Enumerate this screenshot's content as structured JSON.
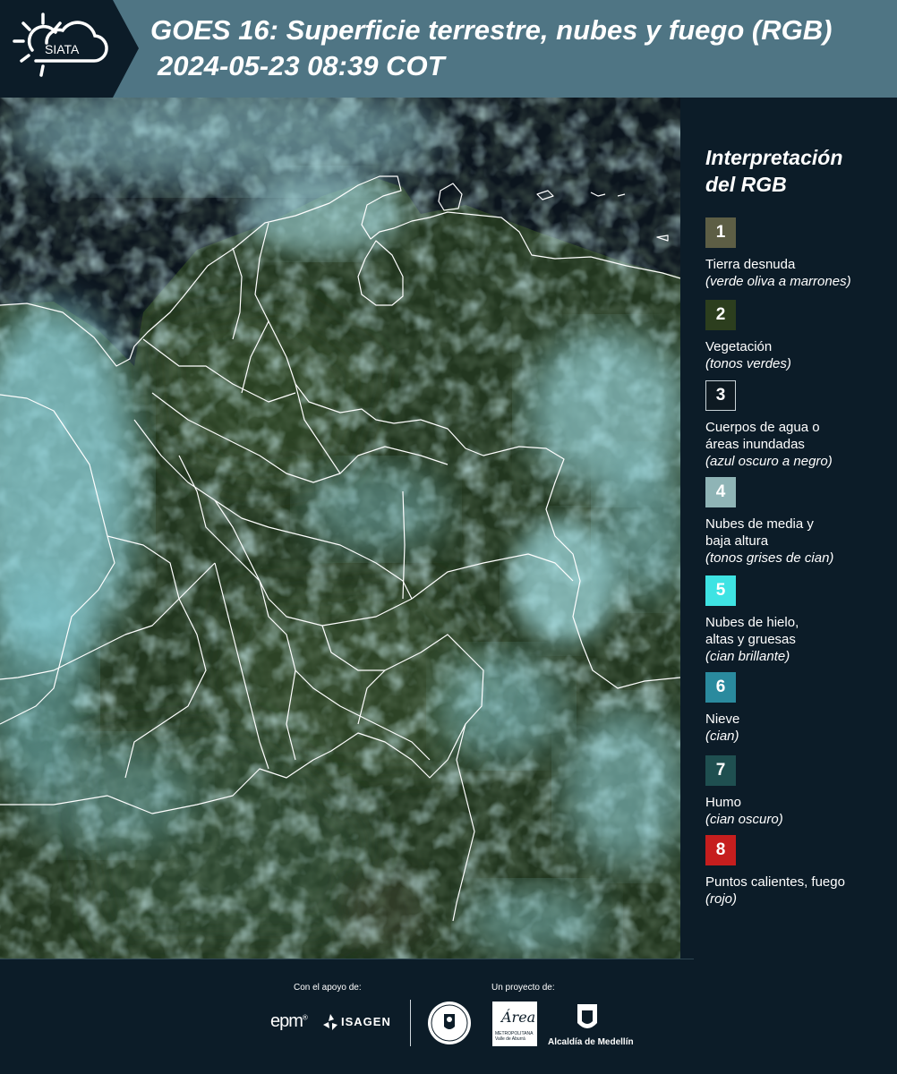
{
  "header": {
    "logo_text": "SIATA",
    "title_line1": "GOES 16: Superficie terrestre, nubes y fuego (RGB)",
    "title_line2": "2024-05-23 08:39 COT"
  },
  "map": {
    "border_color": "#ffffff",
    "land_color": "#2a3e27",
    "water_color": "#0b141d",
    "cloud_color": "#8fd3dc"
  },
  "legend": {
    "title_line1": "Interpretación",
    "title_line2": "del RGB",
    "items": [
      {
        "number": "1",
        "color": "#5d5e45",
        "label_lines": [
          "Tierra desnuda"
        ],
        "desc": "(verde oliva a marrones)"
      },
      {
        "number": "2",
        "color": "#2c3e1e",
        "label_lines": [
          "Vegetación"
        ],
        "desc": "(tonos verdes)"
      },
      {
        "number": "3",
        "color": "#0e1a22",
        "label_lines": [
          "Cuerpos de agua o",
          "áreas inundadas"
        ],
        "desc": "(azul oscuro a negro)"
      },
      {
        "number": "4",
        "color": "#8fb4b6",
        "label_lines": [
          "Nubes de media y",
          "baja altura"
        ],
        "desc": "(tonos grises de cian)"
      },
      {
        "number": "5",
        "color": "#3ee3e3",
        "label_lines": [
          "Nubes de hielo,",
          "altas y gruesas"
        ],
        "desc": "(cian brillante)"
      },
      {
        "number": "6",
        "color": "#2a8a9e",
        "label_lines": [
          "Nieve"
        ],
        "desc": "(cian)"
      },
      {
        "number": "7",
        "color": "#1f4f50",
        "label_lines": [
          "Humo"
        ],
        "desc": "(cian oscuro)"
      },
      {
        "number": "8",
        "color": "#c61e1e",
        "label_lines": [
          "Puntos calientes, fuego"
        ],
        "desc": "(rojo)"
      }
    ]
  },
  "footer": {
    "support_label": "Con el apoyo de:",
    "project_label": "Un proyecto de:",
    "epm": "epm",
    "epm_mark": "®",
    "isagen": "ISAGEN",
    "area_script": "Área",
    "area_sub_line1": "METROPOLITANA",
    "area_sub_line2": "Valle de Aburrá",
    "medellin": "Alcaldía de Medellín"
  }
}
